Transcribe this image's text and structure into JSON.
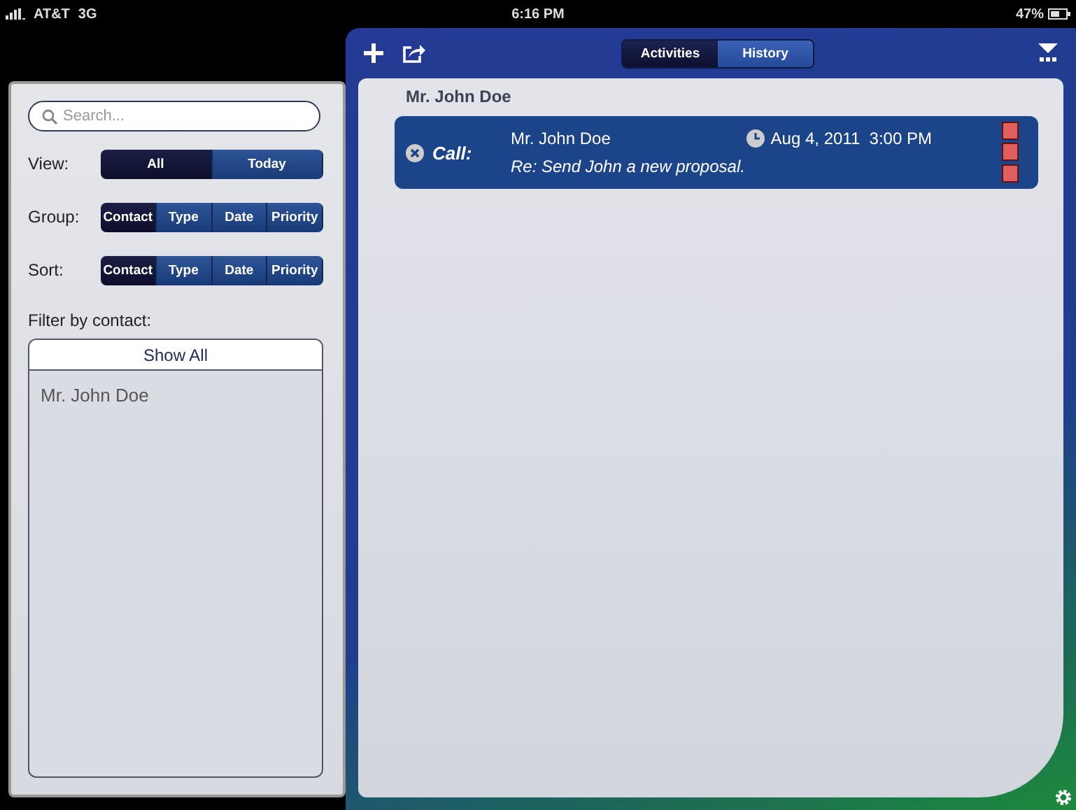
{
  "status_bar": {
    "carrier": "AT&T",
    "network": "3G",
    "time": "6:16 PM",
    "battery": "47%"
  },
  "toolbar": {
    "segments": [
      {
        "label": "Activities",
        "selected": true
      },
      {
        "label": "History",
        "selected": false
      }
    ]
  },
  "filter_panel": {
    "search": {
      "placeholder": "Search..."
    },
    "controls": [
      {
        "label": "View:",
        "options": [
          {
            "label": "All",
            "selected": true
          },
          {
            "label": "Today",
            "selected": false
          }
        ]
      },
      {
        "label": "Group:",
        "options": [
          {
            "label": "Contact",
            "selected": true
          },
          {
            "label": "Type",
            "selected": false
          },
          {
            "label": "Date",
            "selected": false
          },
          {
            "label": "Priority",
            "selected": false
          }
        ]
      },
      {
        "label": "Sort:",
        "options": [
          {
            "label": "Contact",
            "selected": true
          },
          {
            "label": "Type",
            "selected": false
          },
          {
            "label": "Date",
            "selected": false
          },
          {
            "label": "Priority",
            "selected": false
          }
        ]
      }
    ],
    "filter_label": "Filter by contact:",
    "show_all": "Show All",
    "contacts": [
      "Mr. John Doe"
    ]
  },
  "content": {
    "groups": [
      {
        "header": "Mr. John Doe",
        "activities": [
          {
            "type": "Call:",
            "contact": "Mr. John Doe",
            "datetime": "Aug 4, 2011  3:00 PM",
            "subject": "Re: Send John a new proposal."
          }
        ]
      }
    ]
  }
}
